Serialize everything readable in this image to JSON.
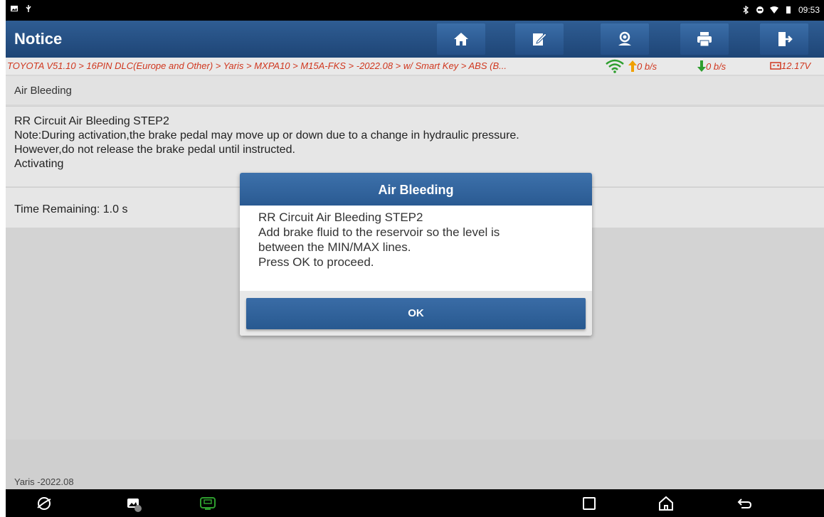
{
  "status_bar": {
    "time": "09:53"
  },
  "title_bar": {
    "title": "Notice",
    "buttons": [
      "home-icon",
      "edit-report-icon",
      "support-icon",
      "print-icon",
      "exit-icon"
    ]
  },
  "breadcrumb": {
    "path": "TOYOTA V51.10 > 16PIN DLC(Europe and Other) > Yaris > MXPA10 > M15A-FKS > -2022.08 > w/ Smart Key > ABS (B...",
    "upload_rate": "0 b/s",
    "download_rate": "0 b/s",
    "battery_voltage": "12.17V"
  },
  "section": {
    "title": "Air Bleeding"
  },
  "message": {
    "lines": [
      "RR Circuit Air Bleeding STEP2",
      "Note:During activation,the brake pedal may move up or down due to a change in hydraulic pressure.",
      "However,do not release the brake pedal until instructed.",
      "Activating"
    ]
  },
  "time_remaining": "Time Remaining: 1.0 s",
  "footer": {
    "vehicle": "Yaris -2022.08"
  },
  "dialog": {
    "title": "Air Bleeding",
    "lines": [
      "RR Circuit Air Bleeding STEP2",
      "Add brake fluid to the reservoir so the level is",
      "between the MIN/MAX lines.",
      "Press OK to proceed."
    ],
    "ok_label": "OK"
  },
  "colors": {
    "accent": "#2a5a92",
    "breadcrumb_text": "#d0371f",
    "rate_up": "#f0a000",
    "rate_down": "#2e9e2e"
  }
}
